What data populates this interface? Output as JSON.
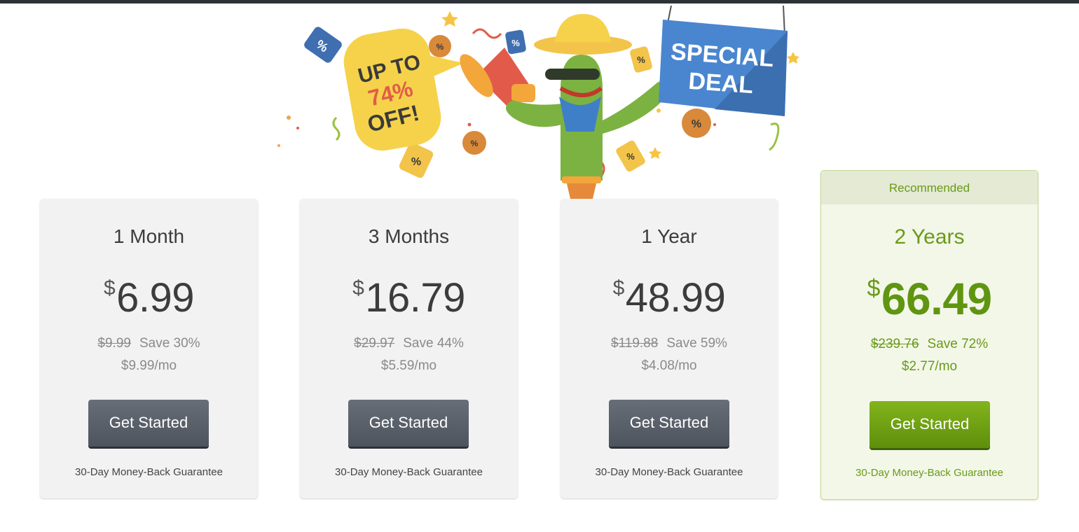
{
  "hero": {
    "bubble_line1": "UP TO",
    "bubble_line2": "74%",
    "bubble_line3": "OFF!",
    "sign_line1": "SPECIAL",
    "sign_line2": "DEAL",
    "tag_text": "%"
  },
  "plans": [
    {
      "name": "1 Month",
      "currency": "$",
      "price": "6.99",
      "original": "$9.99",
      "save": "Save 30%",
      "per_month": "$9.99/mo",
      "button": "Get Started",
      "guarantee": "30-Day Money-Back Guarantee"
    },
    {
      "name": "3 Months",
      "currency": "$",
      "price": "16.79",
      "original": "$29.97",
      "save": "Save 44%",
      "per_month": "$5.59/mo",
      "button": "Get Started",
      "guarantee": "30-Day Money-Back Guarantee"
    },
    {
      "name": "1 Year",
      "currency": "$",
      "price": "48.99",
      "original": "$119.88",
      "save": "Save 59%",
      "per_month": "$4.08/mo",
      "button": "Get Started",
      "guarantee": "30-Day Money-Back Guarantee"
    },
    {
      "name": "2 Years",
      "badge": "Recommended",
      "currency": "$",
      "price": "66.49",
      "original": "$239.76",
      "save": "Save 72%",
      "per_month": "$2.77/mo",
      "button": "Get Started",
      "guarantee": "30-Day Money-Back Guarantee"
    }
  ],
  "colors": {
    "dark_button": "#5a6069",
    "green_accent": "#6a9a1a",
    "recommended_bg": "#f3f7e8",
    "card_bg": "#f2f2f2"
  }
}
